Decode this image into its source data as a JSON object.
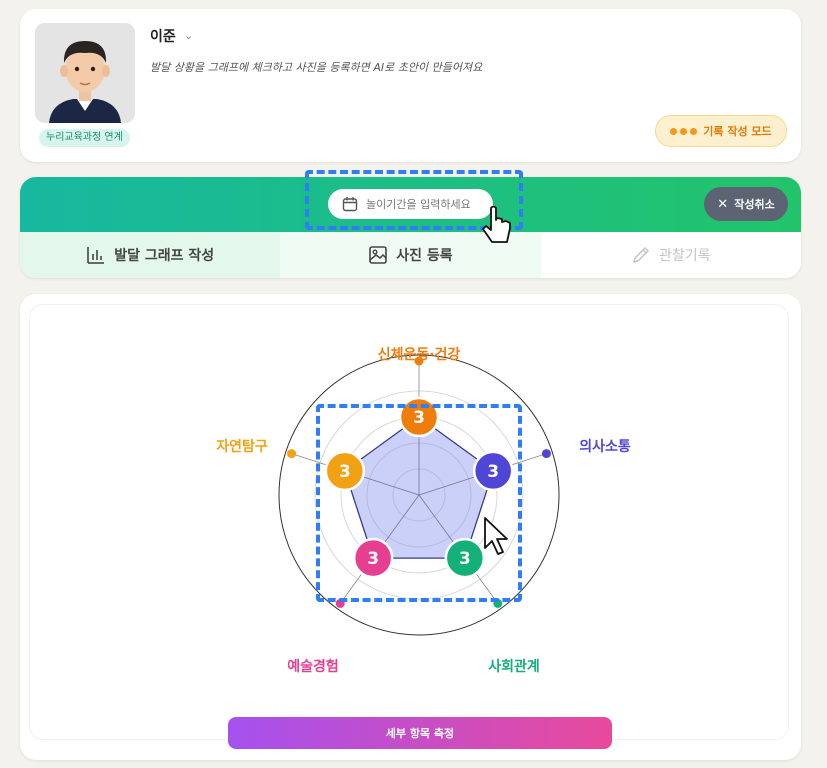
{
  "profile": {
    "name": "이준",
    "guide": "발달 상황을 그래프에 체크하고 사진을 등록하면 AI로 초안이 만들어져요",
    "curriculum_badge": "누리교육과정 연계",
    "mode_button": "기록 작성 모드"
  },
  "banner": {
    "period_placeholder": "놀이기간을 입력하세요",
    "cancel_label": "작성취소"
  },
  "tabs": [
    {
      "label": "발달 그래프 작성",
      "icon": "bar-chart-icon"
    },
    {
      "label": "사진 등록",
      "icon": "image-icon"
    },
    {
      "label": "관찰기록",
      "icon": "pencil-icon"
    }
  ],
  "chart_data": {
    "type": "radar",
    "categories": [
      "신체운동·건강",
      "의사소통",
      "사회관계",
      "예술경험",
      "자연탐구"
    ],
    "values": [
      3,
      3,
      3,
      3,
      3
    ],
    "max": 5,
    "colors": [
      "#ef7d0c",
      "#4f46d8",
      "#14b07a",
      "#e63f92",
      "#f3a114"
    ]
  },
  "measure_button": "세부 항목 측정",
  "colors": {
    "accent_green": "#22c46a",
    "accent_teal": "#17b8a0",
    "highlight": "#2f7ef3"
  }
}
